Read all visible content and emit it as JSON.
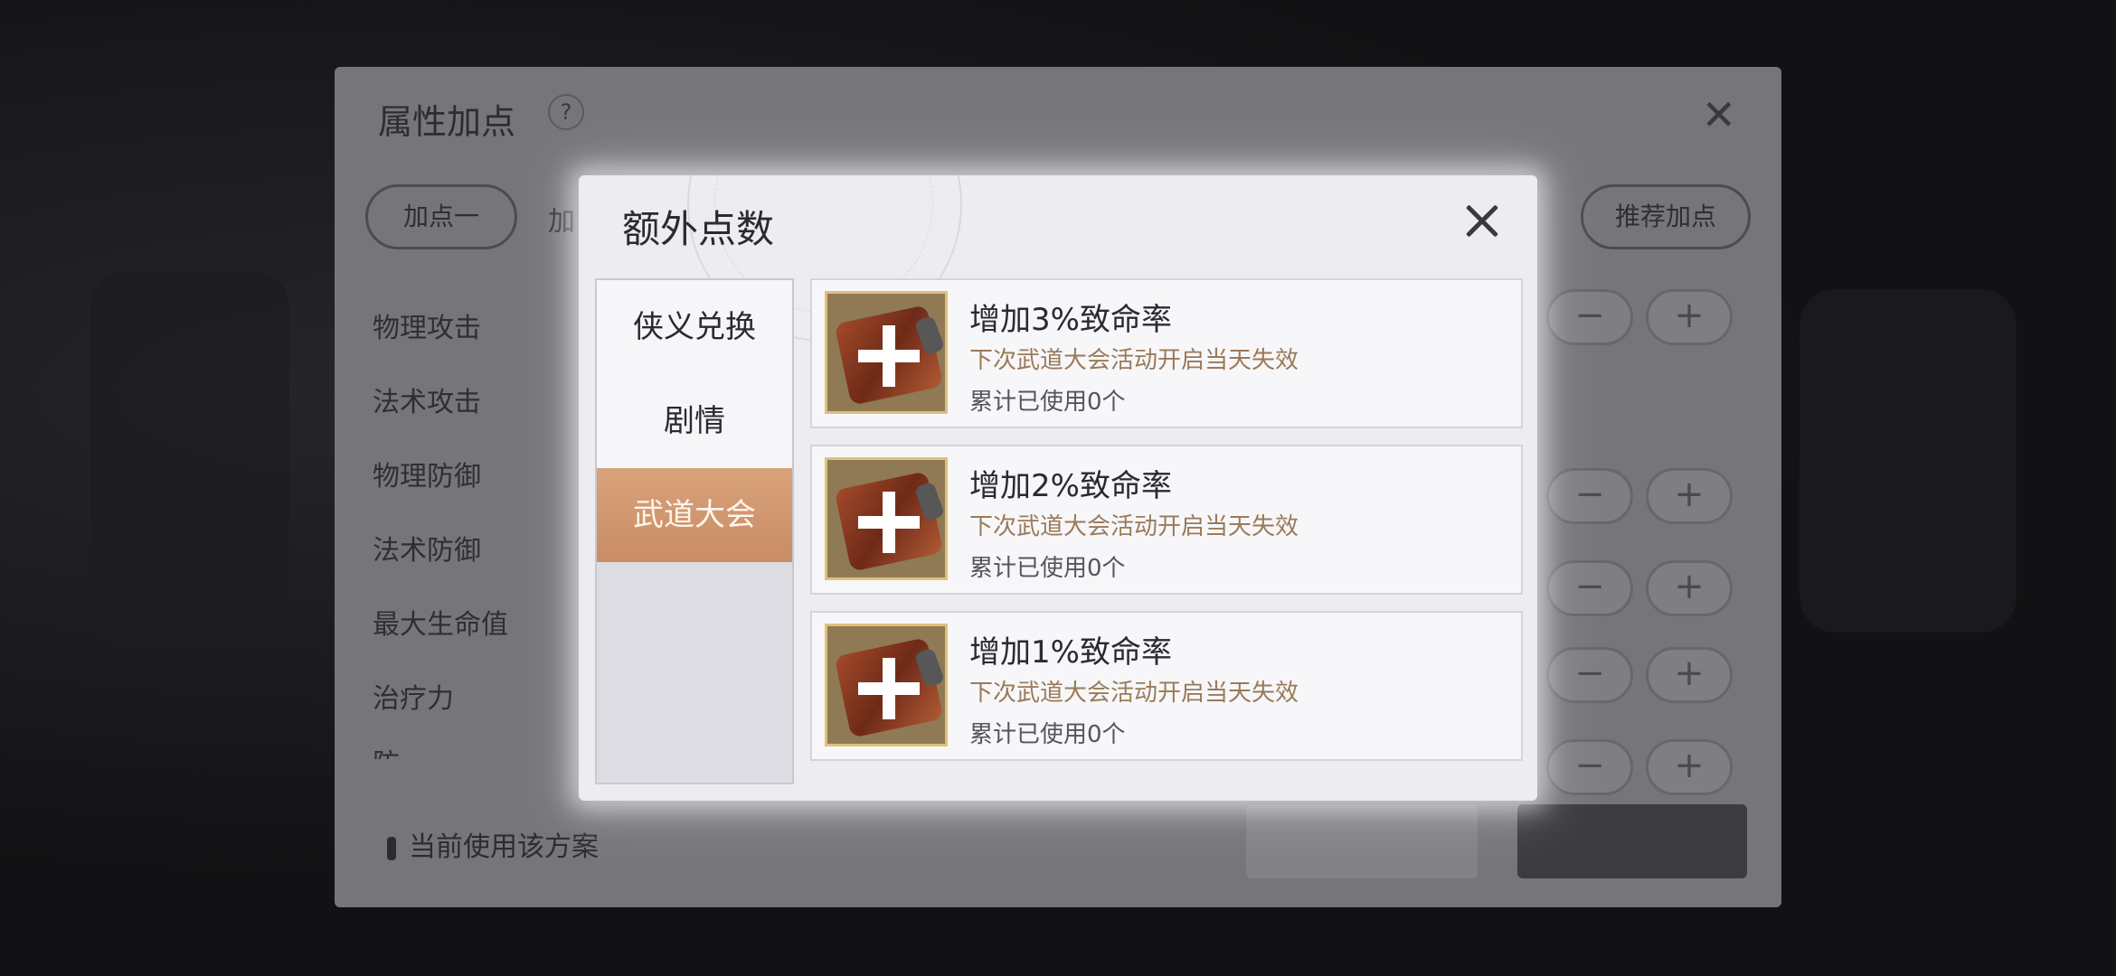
{
  "background_panel": {
    "title": "属性加点",
    "help_icon": "?",
    "close_icon": "✕",
    "scheme_tab_1": "加点一",
    "scheme_tab_2_partial": "加",
    "recommend_button": "推荐加点",
    "stats": [
      "物理攻击",
      "法术攻击",
      "物理防御",
      "法术防御",
      "最大生命值",
      "治疗力",
      "防"
    ],
    "minus_label": "−",
    "plus_label": "+",
    "current_scheme_text": "当前使用该方案"
  },
  "modal": {
    "title": "额外点数",
    "close_icon": "close-icon",
    "tabs": [
      {
        "label": "侠义兑换",
        "active": false
      },
      {
        "label": "剧情",
        "active": false
      },
      {
        "label": "武道大会",
        "active": true
      }
    ],
    "items": [
      {
        "name": "增加3%致命率",
        "expire": "下次武道大会活动开启当天失效",
        "used": "累计已使用0个"
      },
      {
        "name": "增加2%致命率",
        "expire": "下次武道大会活动开启当天失效",
        "used": "累计已使用0个"
      },
      {
        "name": "增加1%致命率",
        "expire": "下次武道大会活动开启当天失效",
        "used": "累计已使用0个"
      }
    ]
  },
  "colors": {
    "active_tab": "#c98d66",
    "expire_text": "#9a7a58",
    "icon_frame": "#e0c07a"
  }
}
